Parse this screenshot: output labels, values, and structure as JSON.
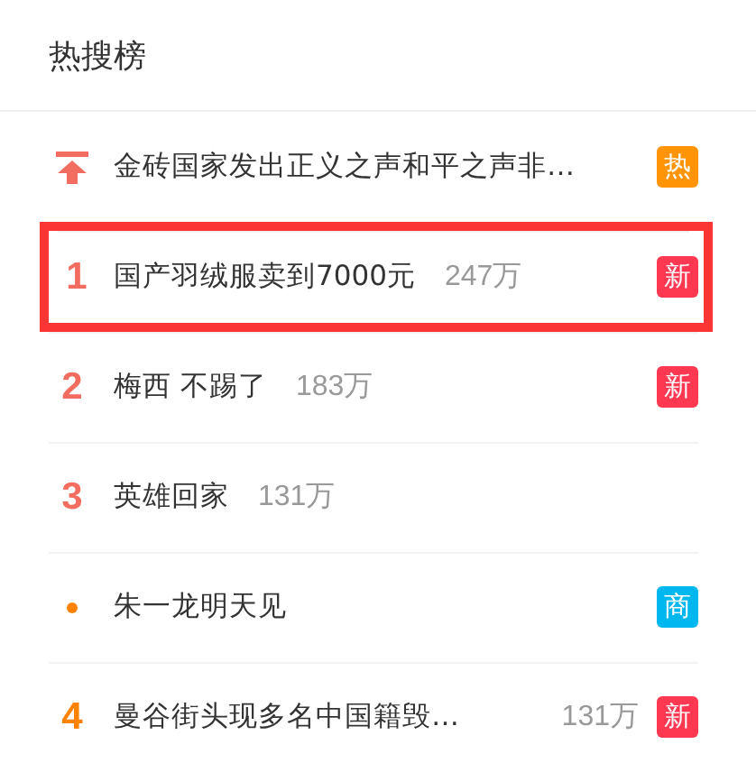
{
  "header": {
    "title": "热搜榜"
  },
  "items": [
    {
      "kind": "pin",
      "title": "金砖国家发出正义之声和平之声非…",
      "badge": {
        "text": "热",
        "color": "#ff9406"
      },
      "highlighted": false
    },
    {
      "kind": "number",
      "rank": "1",
      "color": "#f26d5f",
      "title": "国产羽绒服卖到7000元",
      "count": "247万",
      "badge": {
        "text": "新",
        "color": "#ff3852"
      },
      "highlighted": true
    },
    {
      "kind": "number",
      "rank": "2",
      "color": "#f26d5f",
      "title": "梅西 不踢了",
      "count": "183万",
      "badge": {
        "text": "新",
        "color": "#ff3852"
      },
      "highlighted": false
    },
    {
      "kind": "number",
      "rank": "3",
      "color": "#f26d5f",
      "title": "英雄回家",
      "count": "131万",
      "highlighted": false
    },
    {
      "kind": "dot",
      "color": "#ff8200",
      "title": "朱一龙明天见",
      "badge": {
        "text": "商",
        "color": "#00b7ee"
      },
      "highlighted": false
    },
    {
      "kind": "number",
      "rank": "4",
      "color": "#ff8200",
      "title": "曼谷街头现多名中国籍毁…",
      "count": "131万",
      "badge": {
        "text": "新",
        "color": "#ff3852"
      },
      "highlighted": false
    }
  ]
}
